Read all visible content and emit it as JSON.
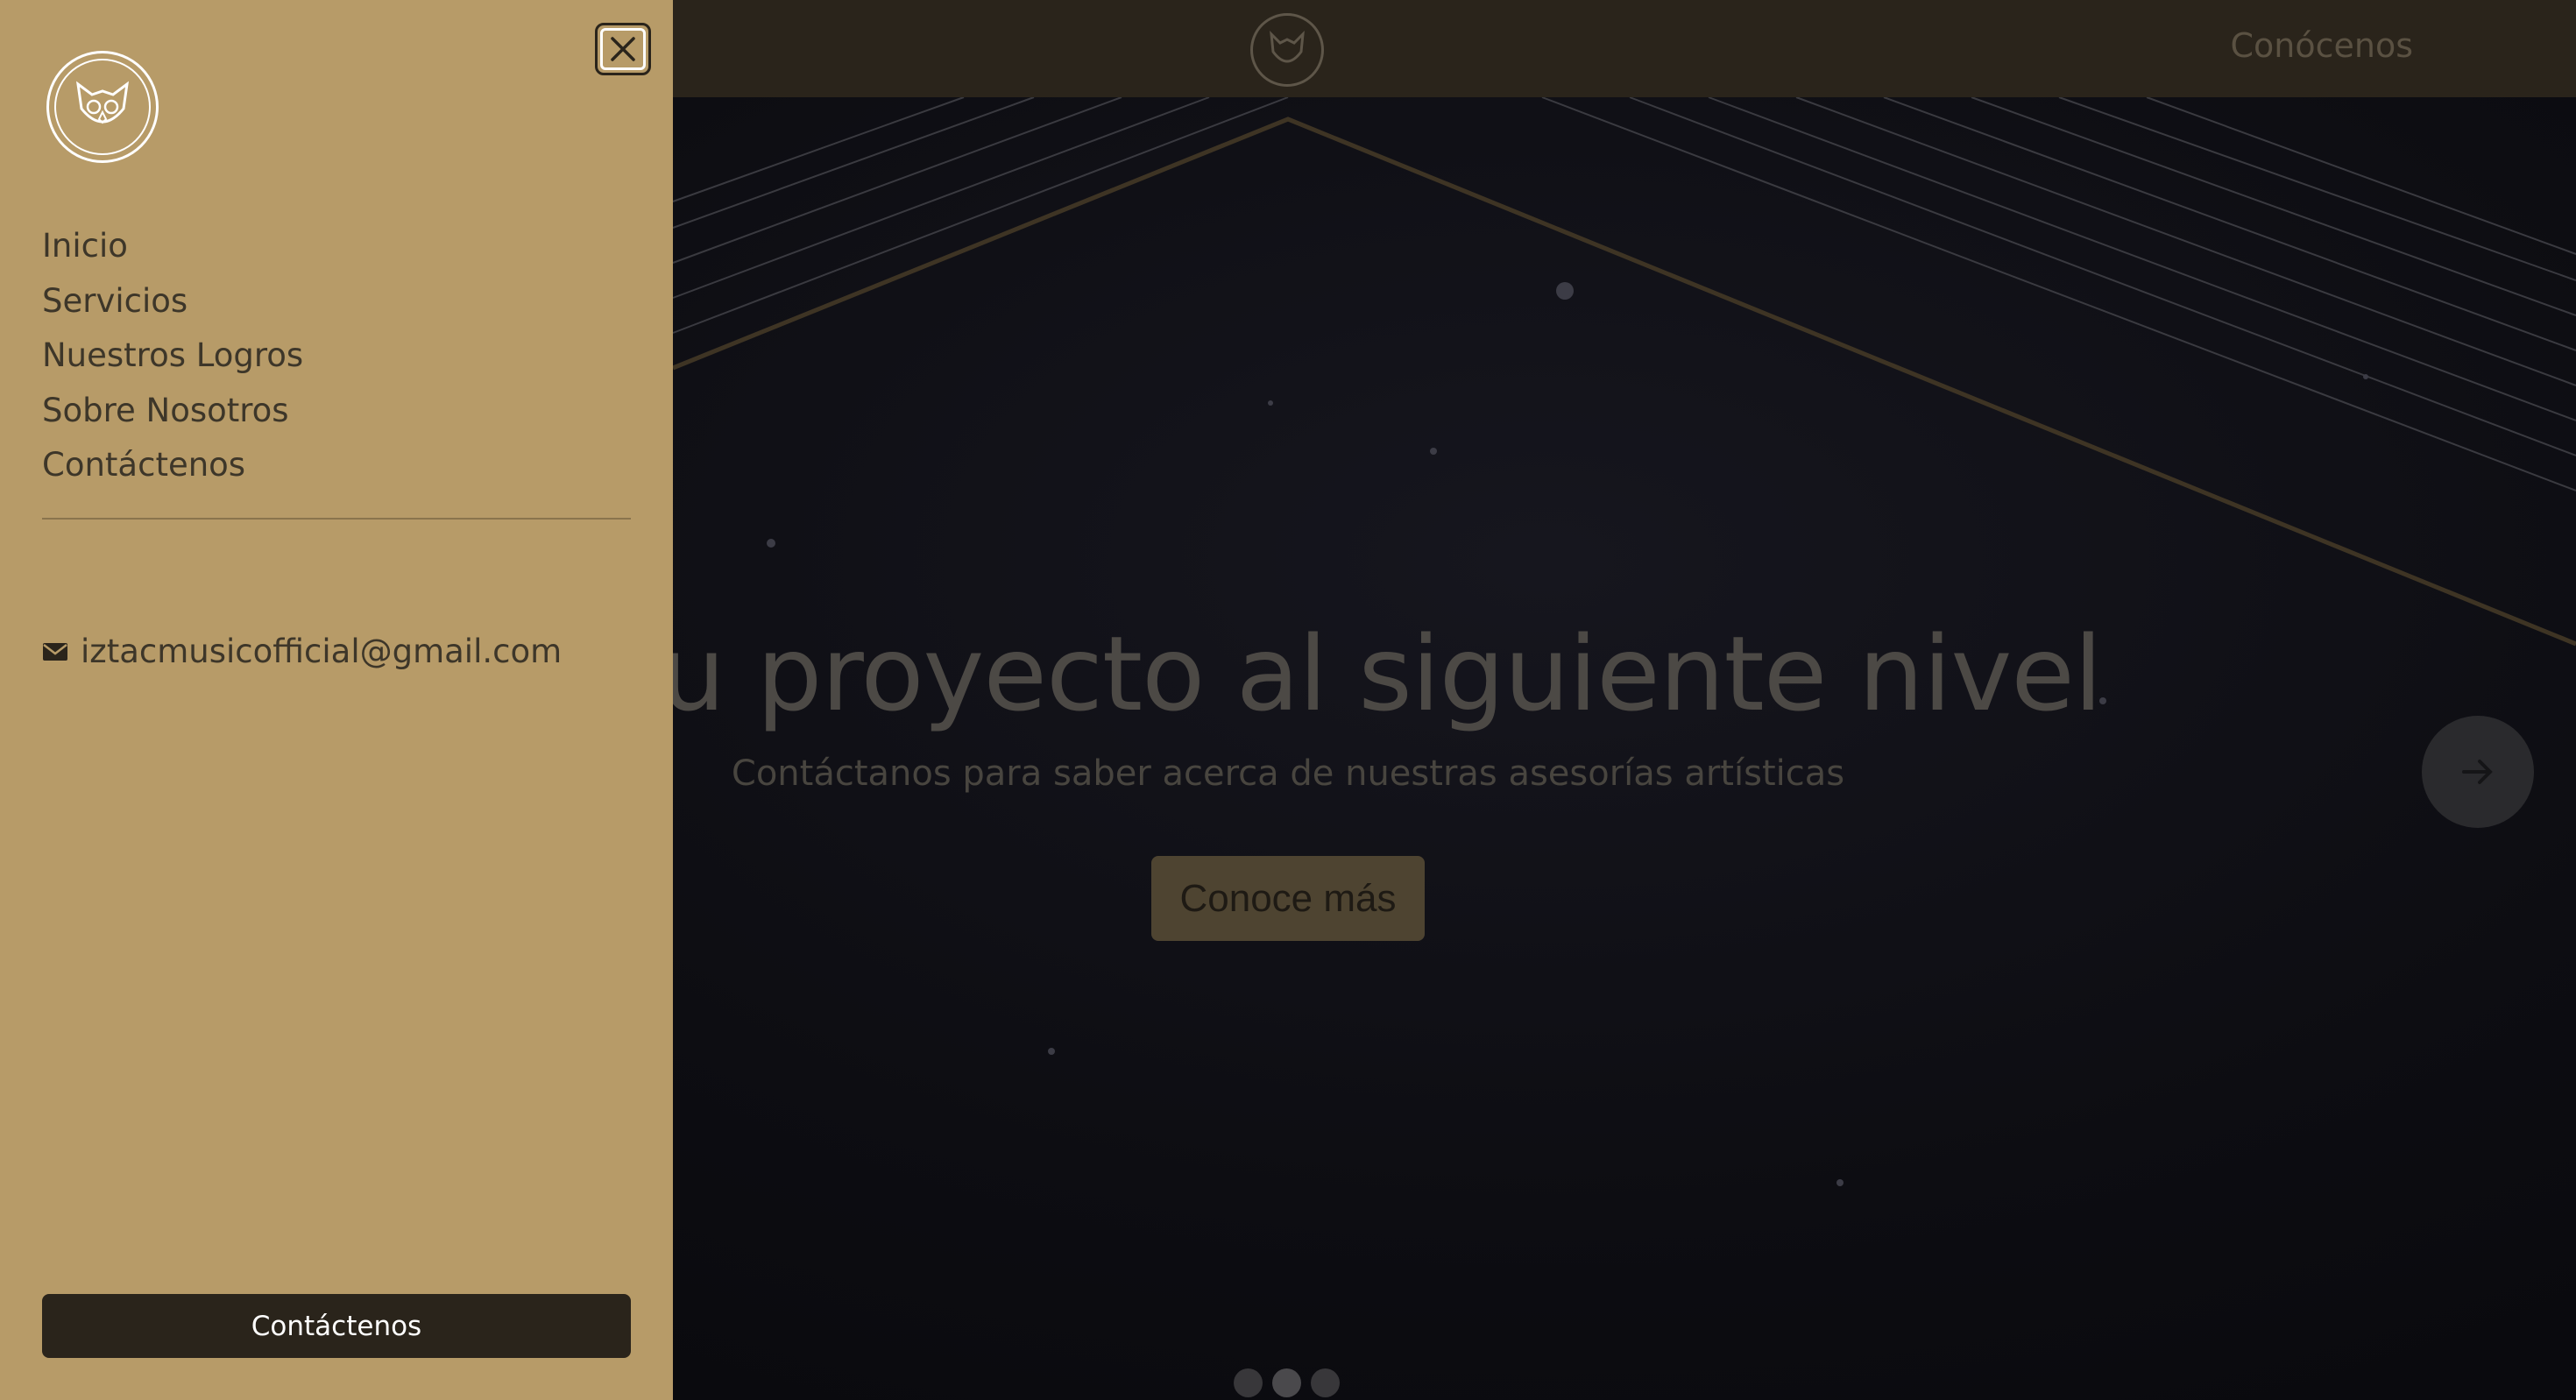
{
  "header": {
    "logo_icon": "owl-logo-icon",
    "nav_link": "Conócenos"
  },
  "hero": {
    "title": "va tu proyecto al siguiente nivel",
    "subtitle": "Contáctanos para saber acerca de nuestras asesorías artísticas",
    "cta_label": "Conoce más",
    "next_icon": "arrow-right-icon",
    "slides_count": 3,
    "active_slide": 2
  },
  "drawer": {
    "logo_icon": "owl-logo-icon",
    "close_icon": "close-icon",
    "nav_items": [
      "Inicio",
      "Servicios",
      "Nuestros Logros",
      "Sobre Nosotros",
      "Contáctenos"
    ],
    "email_icon": "mail-icon",
    "email": "iztacmusicofficial@gmail.com",
    "cta_label": "Contáctenos"
  },
  "colors": {
    "drawer_bg": "#b79b68",
    "topbar_bg": "#2a241b",
    "dark_button": "#2a241b",
    "drawer_text": "#3d3629"
  }
}
